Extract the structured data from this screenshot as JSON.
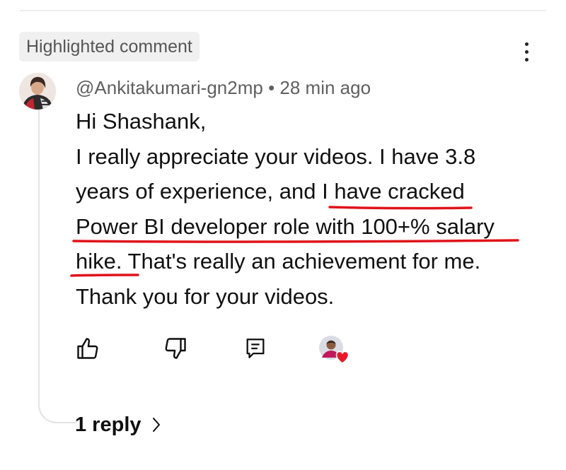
{
  "badge": {
    "label": "Highlighted comment"
  },
  "comment": {
    "author": "@Ankitakumari-gn2mp",
    "separator": "•",
    "time": "28 min ago",
    "lines": [
      "Hi Shashank,",
      "I really appreciate your videos. I have 3.8",
      "years of experience, and  I have cracked",
      "Power BI developer role with 100+% salary",
      "hike. That's really an achievement for me.",
      "Thank you for your videos."
    ]
  },
  "replies": {
    "label": "1 reply"
  },
  "icons": {
    "menu": "more-vertical-icon",
    "like": "thumbs-up-icon",
    "dislike": "thumbs-down-icon",
    "reply": "comment-icon",
    "creator_heart": "creator-heart-icon",
    "chevron": "chevron-right-icon"
  },
  "colors": {
    "annotation_underline": "#e0141b",
    "heart": "#e8182c",
    "meta_text": "#606060",
    "badge_bg": "#f0f0f0"
  }
}
